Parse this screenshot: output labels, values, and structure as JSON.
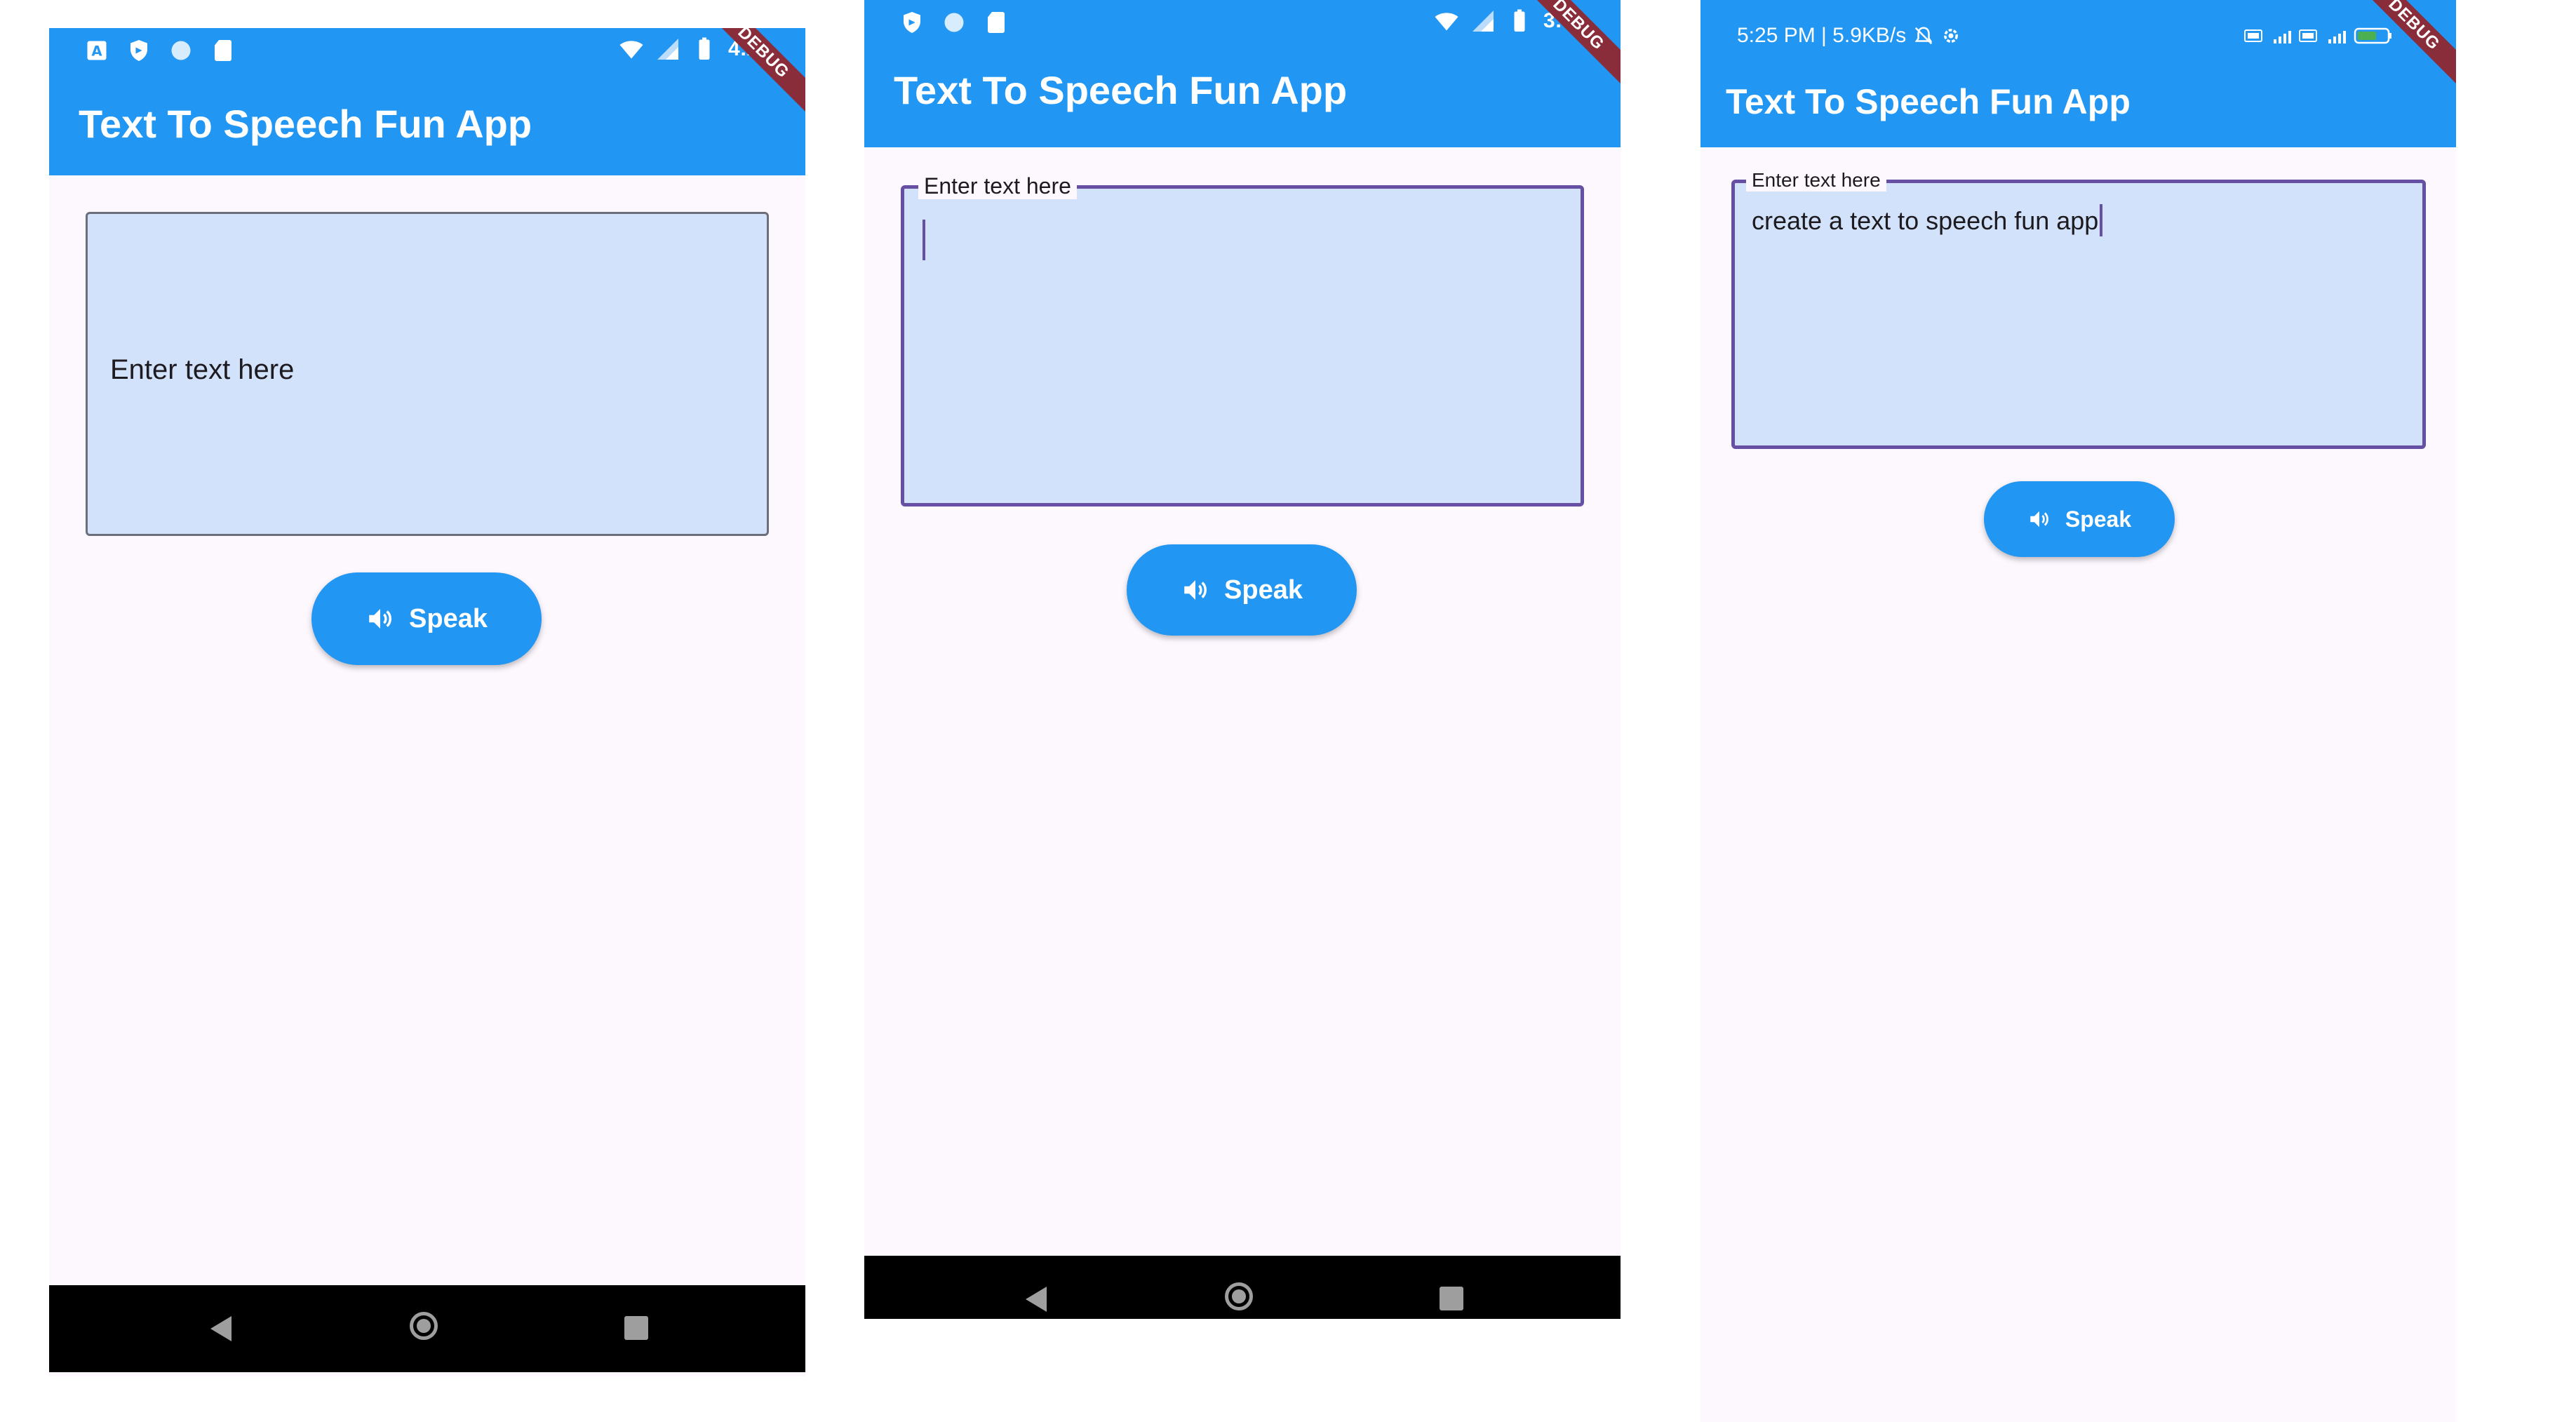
{
  "colors": {
    "app_bar": "#2196f3",
    "background": "#fdf7fe",
    "field_fill": "#d2e2fa",
    "focus_border": "#6750a4",
    "nav_bar": "#000000",
    "debug_ribbon": "#8a2d3a"
  },
  "screens": [
    {
      "status": {
        "time": "4:28",
        "left_icons": [
          "a-icon",
          "shield-icon",
          "circle-icon",
          "sd-card-icon"
        ],
        "right_icons": [
          "wifi-icon",
          "signal-icon",
          "battery-icon"
        ]
      },
      "debug_label": "DEBUG",
      "title": "Text To Speech Fun App",
      "text_field": {
        "placeholder": "Enter text here",
        "state": "unfocused"
      },
      "speak_button": {
        "label": "Speak",
        "icon": "volume-icon"
      },
      "nav": [
        "back-icon",
        "home-icon",
        "recents-icon"
      ]
    },
    {
      "status": {
        "time": "3:55",
        "left_icons": [
          "shield-icon",
          "circle-icon",
          "sd-card-icon"
        ],
        "right_icons": [
          "wifi-icon",
          "signal-icon",
          "battery-icon"
        ]
      },
      "debug_label": "DEBUG",
      "title": "Text To Speech Fun App",
      "text_field": {
        "label": "Enter text here",
        "value": "",
        "state": "focused"
      },
      "speak_button": {
        "label": "Speak",
        "icon": "volume-icon"
      },
      "nav": [
        "back-icon",
        "home-icon",
        "recents-icon"
      ]
    },
    {
      "status": {
        "time": "5:25 PM | 5.9KB/s",
        "left_icons": [
          "mute-bell-icon",
          "settings-icon"
        ],
        "right_icons": [
          "volte-icon",
          "signal-4g-icon",
          "volte-icon",
          "signal-icon",
          "battery-icon"
        ],
        "battery_level": "51"
      },
      "debug_label": "DEBUG",
      "title": "Text To Speech Fun App",
      "text_field": {
        "label": "Enter text here",
        "value": "create a text to speech fun app",
        "state": "focused"
      },
      "speak_button": {
        "label": "Speak",
        "icon": "volume-icon"
      }
    }
  ]
}
